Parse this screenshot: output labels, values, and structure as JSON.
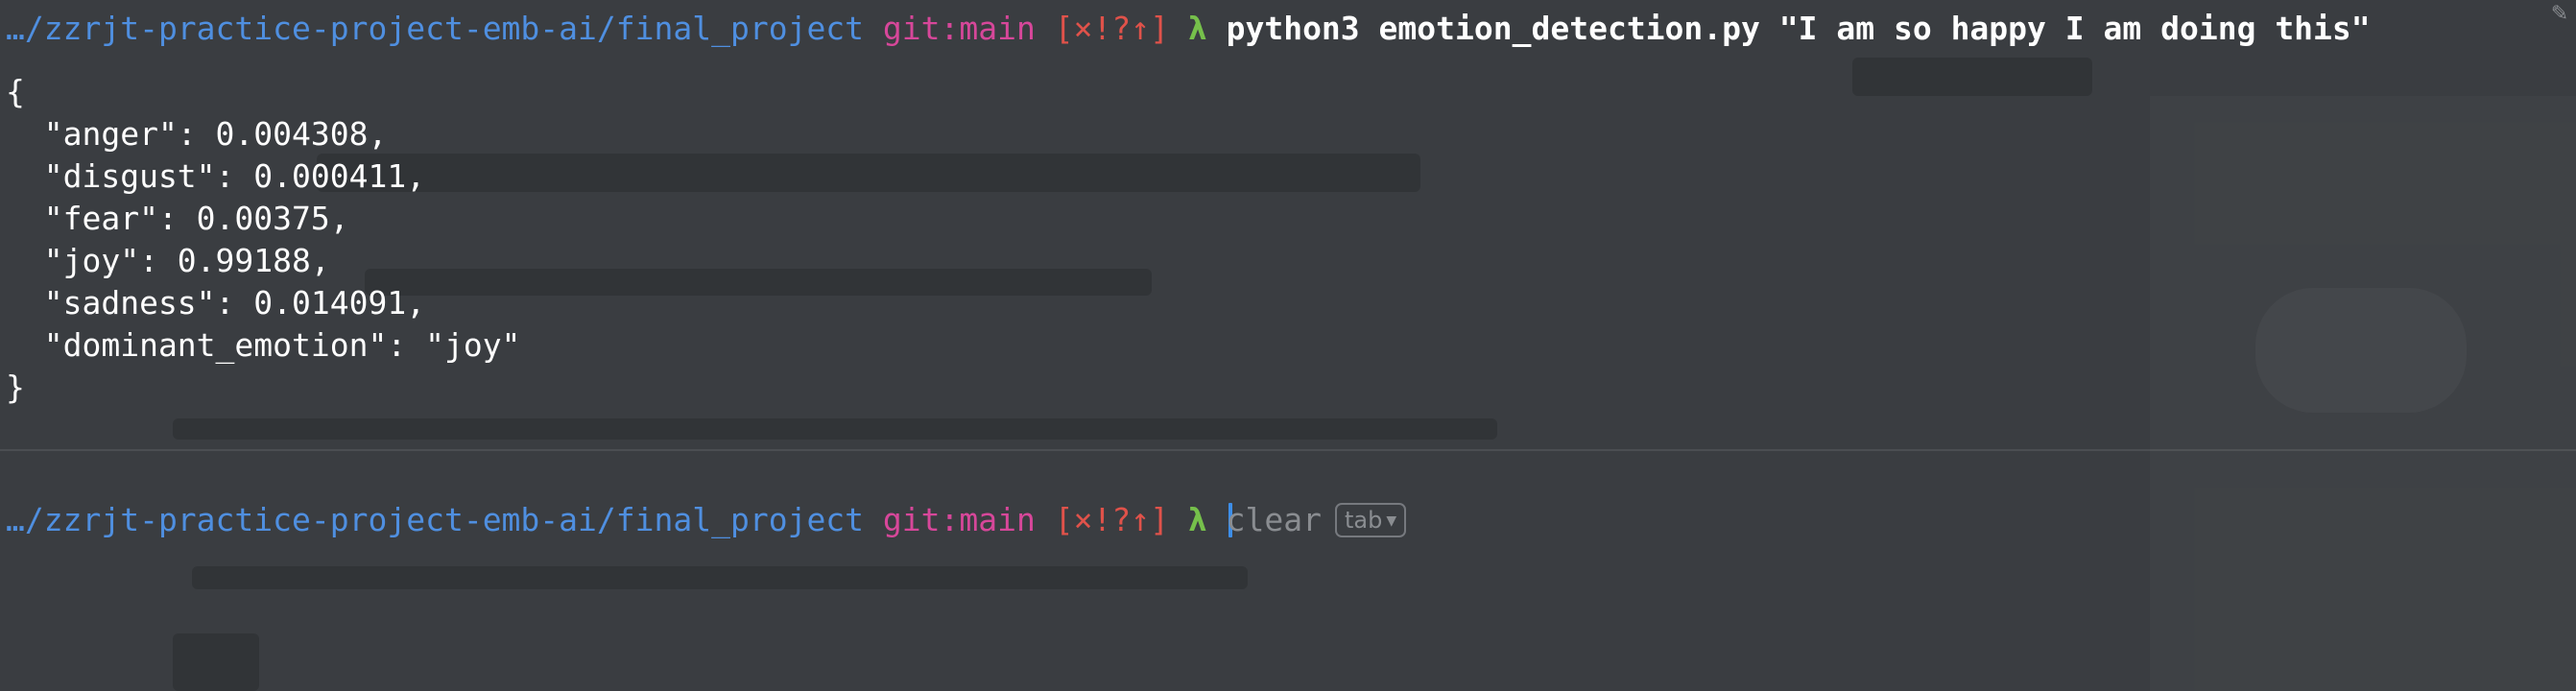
{
  "prompt": {
    "path": "…/zzrjt-practice-project-emb-ai/final_project",
    "git_branch": "git:main",
    "git_status": "[×!?↑]",
    "symbol": "λ"
  },
  "session": {
    "command": "python3 emotion_detection.py \"I am so happy I am doing this\"",
    "output_lines": [
      "{",
      "  \"anger\": 0.004308,",
      "  \"disgust\": 0.000411,",
      "  \"fear\": 0.00375,",
      "  \"joy\": 0.99188,",
      "  \"sadness\": 0.014091,",
      "  \"dominant_emotion\": \"joy\"",
      "}"
    ]
  },
  "input": {
    "typed_char": "c",
    "suggestion_rest": "lear",
    "tab_hint": "tab"
  },
  "colors": {
    "background": "#3a3d41",
    "path": "#4f8fe0",
    "git_branch": "#d7479a",
    "git_status": "#e0524a",
    "lambda": "#76c04b",
    "cursor": "#3d8ee8"
  }
}
